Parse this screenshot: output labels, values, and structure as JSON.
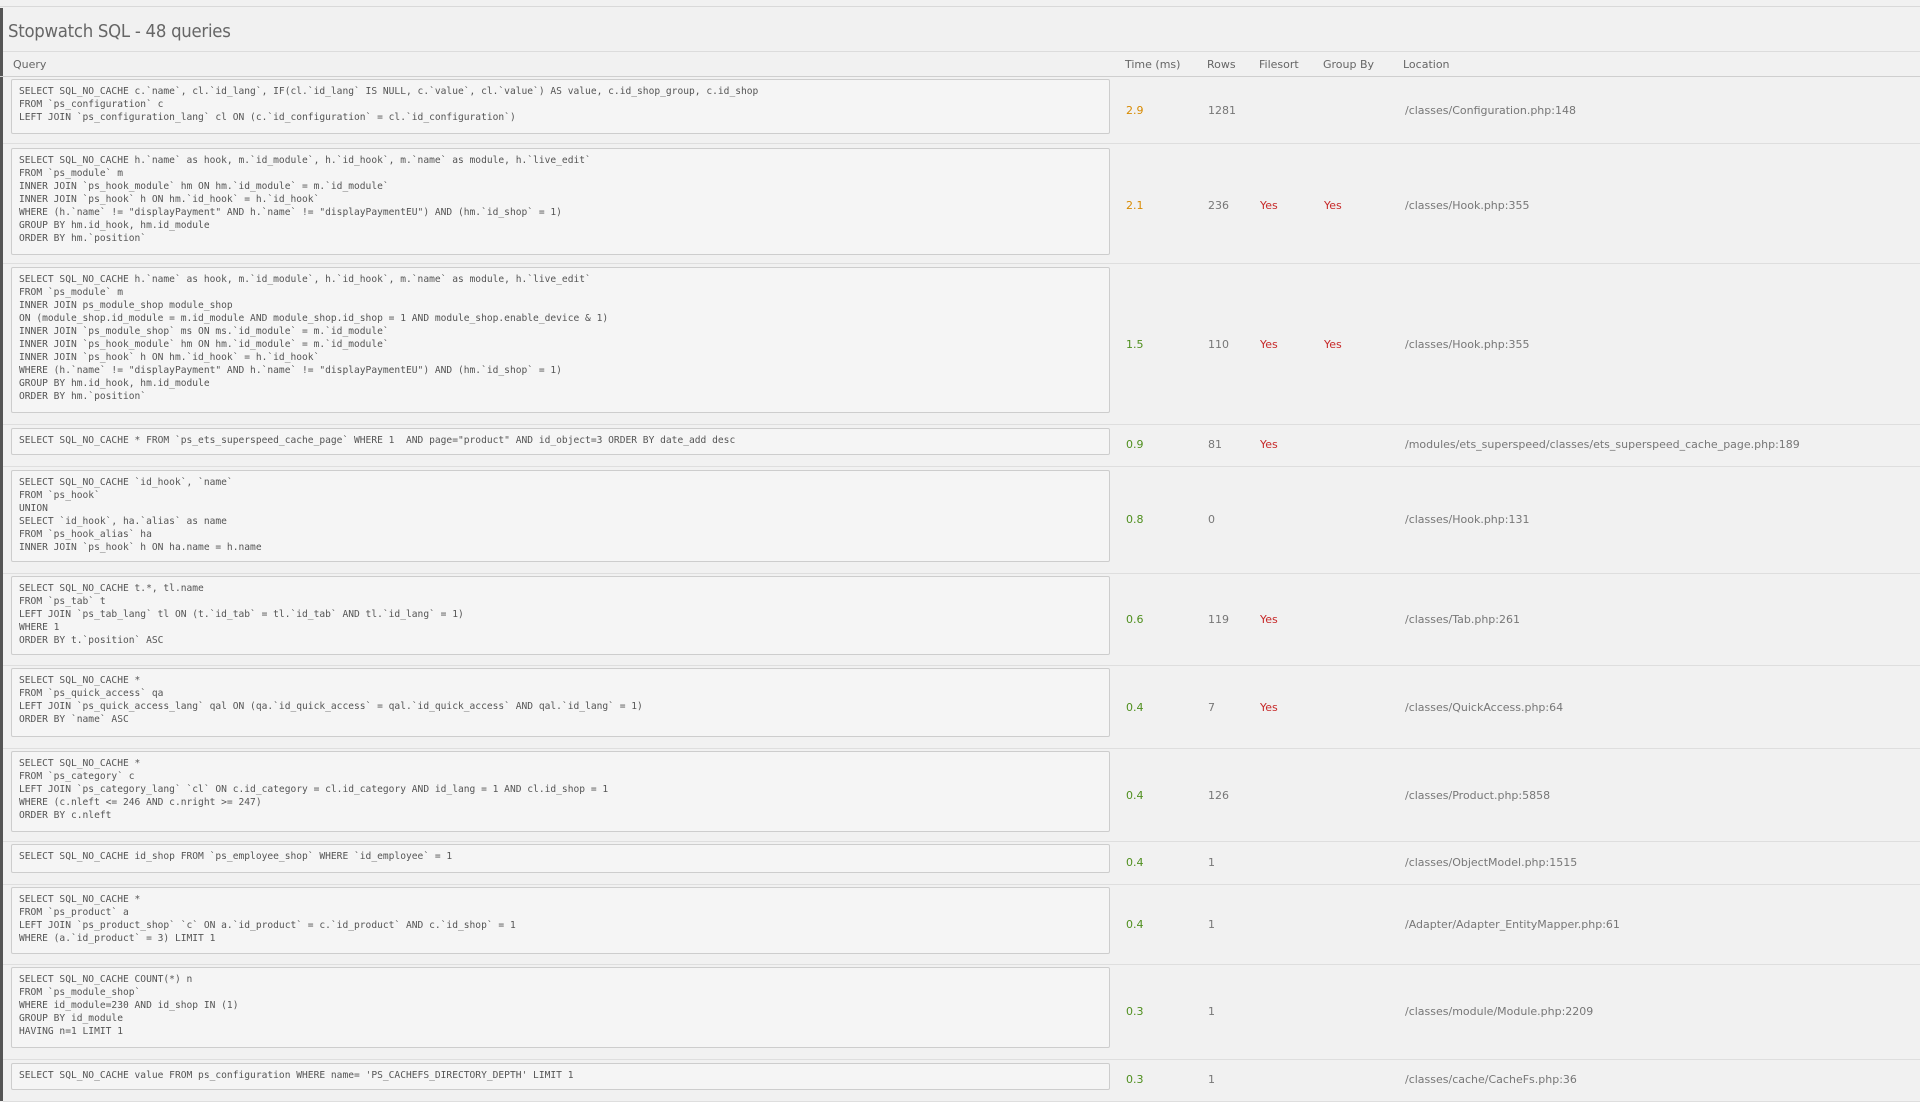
{
  "page": {
    "title": "Stopwatch SQL - 48 queries"
  },
  "table": {
    "headers": {
      "query": "Query",
      "time": "Time (ms)",
      "rows": "Rows",
      "filesort": "Filesort",
      "groupby": "Group By",
      "location": "Location"
    },
    "rows": [
      {
        "query": "SELECT SQL_NO_CACHE c.`name`, cl.`id_lang`, IF(cl.`id_lang` IS NULL, c.`value`, cl.`value`) AS value, c.id_shop_group, c.id_shop\nFROM `ps_configuration` c\nLEFT JOIN `ps_configuration_lang` cl ON (c.`id_configuration` = cl.`id_configuration`)",
        "time": "2.9",
        "time_level": "orange",
        "rows": "1281",
        "filesort": "",
        "groupby": "",
        "location": "/classes/Configuration.php:148"
      },
      {
        "query": "SELECT SQL_NO_CACHE h.`name` as hook, m.`id_module`, h.`id_hook`, m.`name` as module, h.`live_edit`\nFROM `ps_module` m\nINNER JOIN `ps_hook_module` hm ON hm.`id_module` = m.`id_module`\nINNER JOIN `ps_hook` h ON hm.`id_hook` = h.`id_hook`\nWHERE (h.`name` != \"displayPayment\" AND h.`name` != \"displayPaymentEU\") AND (hm.`id_shop` = 1)\nGROUP BY hm.id_hook, hm.id_module\nORDER BY hm.`position`",
        "time": "2.1",
        "time_level": "orange",
        "rows": "236",
        "filesort": "Yes",
        "groupby": "Yes",
        "location": "/classes/Hook.php:355"
      },
      {
        "query": "SELECT SQL_NO_CACHE h.`name` as hook, m.`id_module`, h.`id_hook`, m.`name` as module, h.`live_edit`\nFROM `ps_module` m\nINNER JOIN ps_module_shop module_shop\nON (module_shop.id_module = m.id_module AND module_shop.id_shop = 1 AND module_shop.enable_device & 1)\nINNER JOIN `ps_module_shop` ms ON ms.`id_module` = m.`id_module`\nINNER JOIN `ps_hook_module` hm ON hm.`id_module` = m.`id_module`\nINNER JOIN `ps_hook` h ON hm.`id_hook` = h.`id_hook`\nWHERE (h.`name` != \"displayPayment\" AND h.`name` != \"displayPaymentEU\") AND (hm.`id_shop` = 1)\nGROUP BY hm.id_hook, hm.id_module\nORDER BY hm.`position`",
        "time": "1.5",
        "time_level": "green",
        "rows": "110",
        "filesort": "Yes",
        "groupby": "Yes",
        "location": "/classes/Hook.php:355"
      },
      {
        "query": "SELECT SQL_NO_CACHE * FROM `ps_ets_superspeed_cache_page` WHERE 1  AND page=\"product\" AND id_object=3 ORDER BY date_add desc",
        "time": "0.9",
        "time_level": "green",
        "rows": "81",
        "filesort": "Yes",
        "groupby": "",
        "location": "/modules/ets_superspeed/classes/ets_superspeed_cache_page.php:189"
      },
      {
        "query": "SELECT SQL_NO_CACHE `id_hook`, `name`\nFROM `ps_hook`\nUNION\nSELECT `id_hook`, ha.`alias` as name\nFROM `ps_hook_alias` ha\nINNER JOIN `ps_hook` h ON ha.name = h.name",
        "time": "0.8",
        "time_level": "green",
        "rows": "0",
        "filesort": "",
        "groupby": "",
        "location": "/classes/Hook.php:131"
      },
      {
        "query": "SELECT SQL_NO_CACHE t.*, tl.name\nFROM `ps_tab` t\nLEFT JOIN `ps_tab_lang` tl ON (t.`id_tab` = tl.`id_tab` AND tl.`id_lang` = 1)\nWHERE 1\nORDER BY t.`position` ASC",
        "time": "0.6",
        "time_level": "green",
        "rows": "119",
        "filesort": "Yes",
        "groupby": "",
        "location": "/classes/Tab.php:261"
      },
      {
        "query": "SELECT SQL_NO_CACHE *\nFROM `ps_quick_access` qa\nLEFT JOIN `ps_quick_access_lang` qal ON (qa.`id_quick_access` = qal.`id_quick_access` AND qal.`id_lang` = 1)\nORDER BY `name` ASC",
        "time": "0.4",
        "time_level": "green",
        "rows": "7",
        "filesort": "Yes",
        "groupby": "",
        "location": "/classes/QuickAccess.php:64"
      },
      {
        "query": "SELECT SQL_NO_CACHE *\nFROM `ps_category` c\nLEFT JOIN `ps_category_lang` `cl` ON c.id_category = cl.id_category AND id_lang = 1 AND cl.id_shop = 1\nWHERE (c.nleft <= 246 AND c.nright >= 247)\nORDER BY c.nleft",
        "time": "0.4",
        "time_level": "green",
        "rows": "126",
        "filesort": "",
        "groupby": "",
        "location": "/classes/Product.php:5858"
      },
      {
        "query": "SELECT SQL_NO_CACHE id_shop FROM `ps_employee_shop` WHERE `id_employee` = 1",
        "time": "0.4",
        "time_level": "green",
        "rows": "1",
        "filesort": "",
        "groupby": "",
        "location": "/classes/ObjectModel.php:1515"
      },
      {
        "query": "SELECT SQL_NO_CACHE *\nFROM `ps_product` a\nLEFT JOIN `ps_product_shop` `c` ON a.`id_product` = c.`id_product` AND c.`id_shop` = 1\nWHERE (a.`id_product` = 3) LIMIT 1",
        "time": "0.4",
        "time_level": "green",
        "rows": "1",
        "filesort": "",
        "groupby": "",
        "location": "/Adapter/Adapter_EntityMapper.php:61"
      },
      {
        "query": "SELECT SQL_NO_CACHE COUNT(*) n\nFROM `ps_module_shop`\nWHERE id_module=230 AND id_shop IN (1)\nGROUP BY id_module\nHAVING n=1 LIMIT 1",
        "time": "0.3",
        "time_level": "green",
        "rows": "1",
        "filesort": "",
        "groupby": "",
        "location": "/classes/module/Module.php:2209"
      },
      {
        "query": "SELECT SQL_NO_CACHE value FROM ps_configuration WHERE name= 'PS_CACHEFS_DIRECTORY_DEPTH' LIMIT 1",
        "time": "0.3",
        "time_level": "green",
        "rows": "1",
        "filesort": "",
        "groupby": "",
        "location": "/classes/cache/CacheFs.php:36"
      }
    ]
  }
}
